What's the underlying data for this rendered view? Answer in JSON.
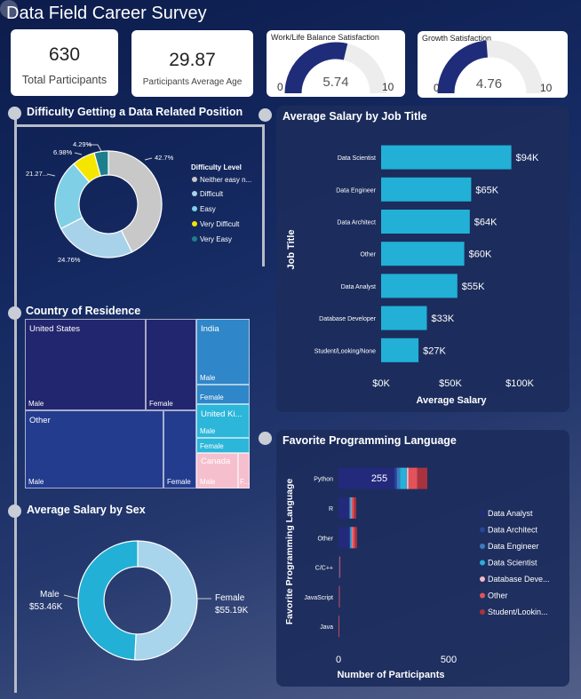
{
  "title": "Data Field Career Survey",
  "kpis": {
    "total": {
      "value": "630",
      "label": "Total Participants"
    },
    "age": {
      "value": "29.87",
      "label": "Participants Average Age"
    }
  },
  "gauges": {
    "wlb": {
      "title": "Work/Life Balance Satisfaction",
      "value": "5.74",
      "min": "0",
      "max": "10",
      "fraction": 0.574
    },
    "growth": {
      "title": "Growth Satisfaction",
      "value": "4.76",
      "min": "0",
      "max": "10",
      "fraction": 0.476
    }
  },
  "difficulty": {
    "title": "Difficulty Getting a Data Related Position",
    "legend_title": "Difficulty Level",
    "labels": {
      "neither": "42.7%",
      "difficult": "24.76%",
      "easy": "21.27...",
      "very_difficult": "6.98%",
      "very_easy": "4.29%"
    },
    "legend": {
      "neither": "Neither easy n...",
      "difficult": "Difficult",
      "easy": "Easy",
      "very_difficult": "Very Difficult",
      "very_easy": "Very Easy"
    }
  },
  "country": {
    "title": "Country of Residence",
    "labels": {
      "us": "United States",
      "us_m": "Male",
      "us_f": "Female",
      "other": "Other",
      "other_m": "Male",
      "other_f": "Female",
      "india": "India",
      "india_m": "Male",
      "india_f": "Female",
      "uk": "United Ki...",
      "uk_m": "Male",
      "uk_f": "Female",
      "canada": "Canada",
      "canada_m": "Male",
      "canada_f": "F..."
    }
  },
  "sex": {
    "title": "Average Salary by Sex",
    "male_label": "Male",
    "male_value": "$53.46K",
    "female_label": "Female",
    "female_value": "$55.19K"
  },
  "salary": {
    "title": "Average Salary by Job Title",
    "ylabel": "Job Title",
    "xlabel": "Average Salary",
    "ticks": [
      "$0K",
      "$50K",
      "$100K"
    ],
    "value_labels": [
      "$94K",
      "$65K",
      "$64K",
      "$60K",
      "$55K",
      "$33K",
      "$27K"
    ]
  },
  "language": {
    "title": "Favorite Programming Language",
    "ylabel": "Favorite Programming Language",
    "xlabel": "Number of Participants",
    "ticks": [
      "0",
      "500"
    ],
    "python_label": "255",
    "legend": [
      "Data Analyst",
      "Data Architect",
      "Data Engineer",
      "Data Scientist",
      "Database Deve...",
      "Other",
      "Student/Lookin..."
    ]
  },
  "chart_data": [
    {
      "type": "pie",
      "title": "Difficulty Getting a Data Related Position",
      "legend_title": "Difficulty Level",
      "categories": [
        "Neither easy n...",
        "Difficult",
        "Easy",
        "Very Difficult",
        "Very Easy"
      ],
      "values": [
        42.7,
        24.76,
        21.27,
        6.98,
        4.29
      ],
      "colors": [
        "#c8c8c8",
        "#a8d2ea",
        "#7fd0e6",
        "#f5e600",
        "#1e7f8c"
      ],
      "legend_position": "right"
    },
    {
      "type": "bar",
      "title": "Average Salary by Job Title",
      "orientation": "horizontal",
      "xlabel": "Average Salary",
      "ylabel": "Job Title",
      "categories": [
        "Data Scientist",
        "Data Engineer",
        "Data Architect",
        "Other",
        "Data Analyst",
        "Database Developer",
        "Student/Looking/None"
      ],
      "values": [
        94,
        65,
        64,
        60,
        55,
        33,
        27
      ],
      "xlim": [
        0,
        110
      ],
      "color": "#22b0d6"
    },
    {
      "type": "pie",
      "title": "Average Salary by Sex",
      "categories": [
        "Male",
        "Female"
      ],
      "values": [
        53.46,
        55.19
      ],
      "colors": [
        "#22b0d6",
        "#a8d4ec"
      ]
    },
    {
      "type": "bar",
      "title": "Favorite Programming Language",
      "orientation": "horizontal",
      "stacked": true,
      "xlabel": "Number of Participants",
      "ylabel": "Favorite Programming Language",
      "categories": [
        "Python",
        "R",
        "Other",
        "C/C++",
        "JavaScript",
        "Java"
      ],
      "xlim": [
        0,
        700
      ],
      "series": [
        {
          "name": "Data Analyst",
          "color": "#232a7c",
          "values": [
            255,
            48,
            50,
            3,
            2,
            1
          ]
        },
        {
          "name": "Data Architect",
          "color": "#26469a",
          "values": [
            10,
            2,
            2,
            0,
            0,
            0
          ]
        },
        {
          "name": "Data Engineer",
          "color": "#3a7cc0",
          "values": [
            15,
            3,
            3,
            1,
            1,
            0
          ]
        },
        {
          "name": "Data Scientist",
          "color": "#29b0d9",
          "values": [
            30,
            5,
            5,
            1,
            0,
            0
          ]
        },
        {
          "name": "Database Deve...",
          "color": "#f4b8c8",
          "values": [
            8,
            2,
            2,
            0,
            0,
            0
          ]
        },
        {
          "name": "Other",
          "color": "#e2525a",
          "values": [
            40,
            10,
            12,
            1,
            1,
            1
          ]
        },
        {
          "name": "Student/Lookin...",
          "color": "#a8323e",
          "values": [
            45,
            10,
            10,
            1,
            1,
            0
          ]
        }
      ],
      "legend_position": "right"
    },
    {
      "type": "treemap",
      "title": "Country of Residence",
      "categories": [
        "United States",
        "Other",
        "India",
        "United Ki...",
        "Canada"
      ]
    }
  ]
}
